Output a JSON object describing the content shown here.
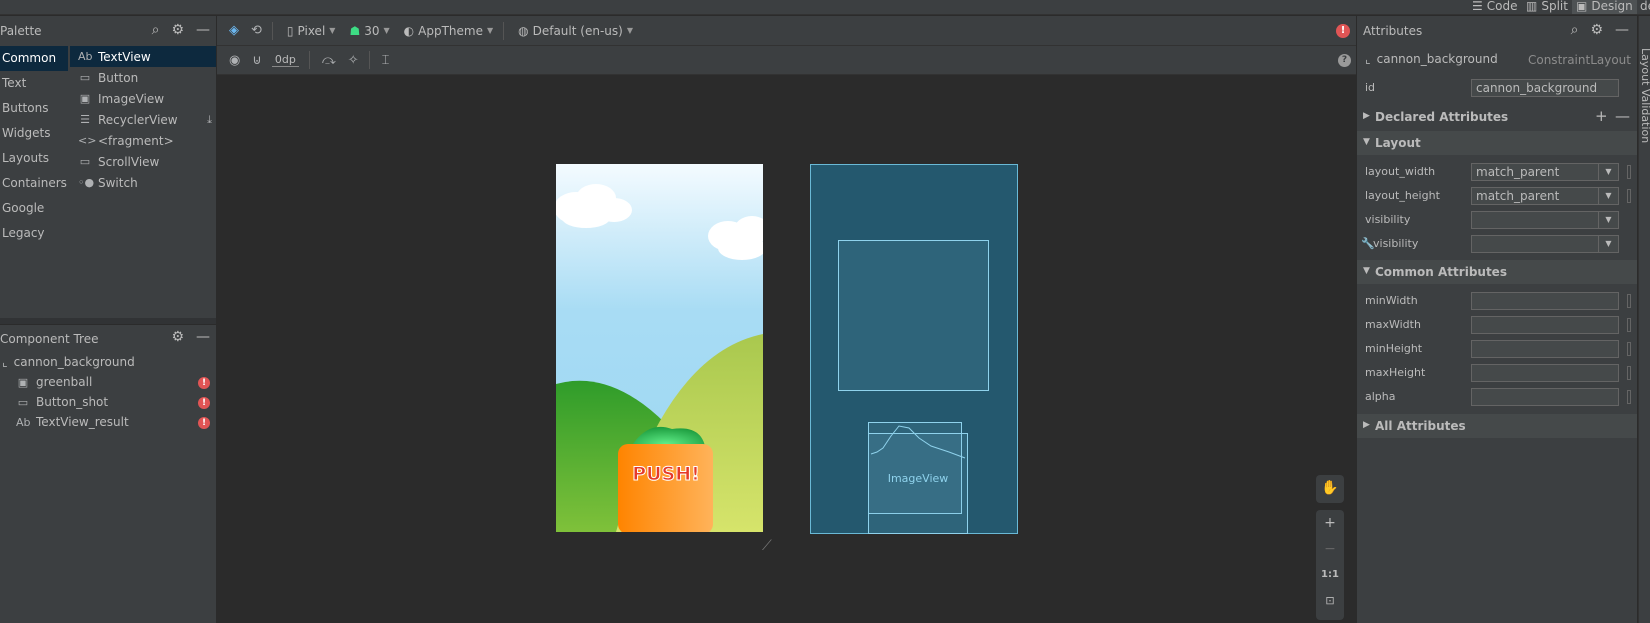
{
  "modes": {
    "code": "Code",
    "split": "Split",
    "design": "Design",
    "edge_partial": "de"
  },
  "palette": {
    "title": "Palette",
    "categories": [
      "Common",
      "Text",
      "Buttons",
      "Widgets",
      "Layouts",
      "Containers",
      "Google",
      "Legacy"
    ],
    "widgets": [
      {
        "icon": "Ab",
        "label": "TextView"
      },
      {
        "icon": "▭",
        "label": "Button"
      },
      {
        "icon": "▣",
        "label": "ImageView"
      },
      {
        "icon": "☰",
        "label": "RecyclerView"
      },
      {
        "icon": "<>",
        "label": "<fragment>"
      },
      {
        "icon": "▭",
        "label": "ScrollView"
      },
      {
        "icon": "◦●",
        "label": "Switch"
      }
    ]
  },
  "tree": {
    "title": "Component Tree",
    "root": "cannon_background",
    "children": [
      {
        "icon": "▣",
        "label": "greenball"
      },
      {
        "icon": "▭",
        "label": "Button_shot"
      },
      {
        "icon": "Ab",
        "label": "TextView_result"
      }
    ]
  },
  "toolbar": {
    "device": "Pixel",
    "api": "30",
    "theme": "AppTheme",
    "locale": "Default (en-us)",
    "margin": "0dp"
  },
  "design": {
    "push_label": "PUSH!",
    "imageview_label": "ImageView"
  },
  "zoom": {
    "fit": "1:1"
  },
  "attributes": {
    "title": "Attributes",
    "component": "cannon_background",
    "type": "ConstraintLayout",
    "id_label": "id",
    "id_value": "cannon_background",
    "sections": {
      "declared": "Declared Attributes",
      "layout": "Layout",
      "common": "Common Attributes",
      "all": "All Attributes"
    },
    "layout_rows": [
      {
        "label": "layout_width",
        "value": "match_parent"
      },
      {
        "label": "layout_height",
        "value": "match_parent"
      },
      {
        "label": "visibility",
        "value": ""
      },
      {
        "label": "visibility",
        "value": ""
      }
    ],
    "common_rows": [
      "minWidth",
      "maxWidth",
      "minHeight",
      "maxHeight",
      "alpha"
    ]
  },
  "rightbar": {
    "label": "Layout Validation"
  },
  "colors": {
    "selection": "#0d293e",
    "blueprint": "#24586e",
    "error": "#e05555",
    "push_orange": "#ff8c00"
  }
}
